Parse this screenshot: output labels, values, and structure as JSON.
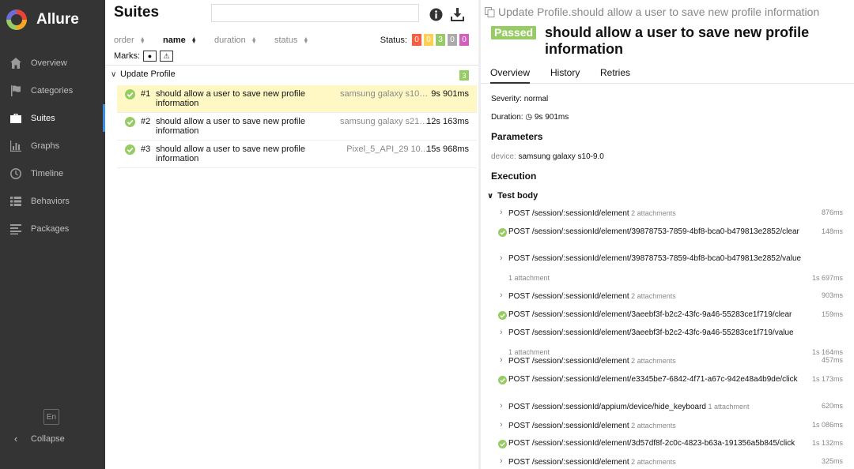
{
  "sidebar": {
    "brand": "Allure",
    "items": [
      {
        "label": "Overview",
        "icon": "home-icon"
      },
      {
        "label": "Categories",
        "icon": "flag-icon"
      },
      {
        "label": "Suites",
        "icon": "briefcase-icon",
        "active": true
      },
      {
        "label": "Graphs",
        "icon": "bar-chart-icon"
      },
      {
        "label": "Timeline",
        "icon": "clock-icon"
      },
      {
        "label": "Behaviors",
        "icon": "list-icon"
      },
      {
        "label": "Packages",
        "icon": "align-left-icon"
      }
    ],
    "language": "En",
    "collapse_label": "Collapse"
  },
  "suites": {
    "title": "Suites",
    "search_value": "",
    "sort_columns": [
      "order",
      "name",
      "duration",
      "status"
    ],
    "status_label": "Status:",
    "status_counts": [
      {
        "value": "0",
        "color": "#fd5a3e"
      },
      {
        "value": "0",
        "color": "#ffd050"
      },
      {
        "value": "3",
        "color": "#97cc64"
      },
      {
        "value": "0",
        "color": "#aaaaaa"
      },
      {
        "value": "0",
        "color": "#d35ebe"
      }
    ],
    "marks_label": "Marks:",
    "group": {
      "name": "Update Profile",
      "count": "3"
    },
    "tests": [
      {
        "num": "#1",
        "name": "should allow a user to save new profile information",
        "param": "samsung galaxy s10-…",
        "duration": "9s 901ms",
        "selected": true
      },
      {
        "num": "#2",
        "name": "should allow a user to save new profile information",
        "param": "samsung galaxy s21-…",
        "duration": "12s 163ms"
      },
      {
        "num": "#3",
        "name": "should allow a user to save new profile information",
        "param": "Pixel_5_API_29 10....",
        "duration": "15s 968ms"
      }
    ]
  },
  "details": {
    "full_path": "Update Profile.should allow a user to save new profile information",
    "status": "Passed",
    "title": "should allow a user to save new profile information",
    "tabs": [
      "Overview",
      "History",
      "Retries"
    ],
    "severity_label": "Severity:",
    "severity_value": "normal",
    "duration_label": "Duration:",
    "duration_value": "9s 901ms",
    "parameters_title": "Parameters",
    "param_key": "device",
    "param_value": "samsung galaxy s10-9.0",
    "execution_title": "Execution",
    "test_body_label": "Test body",
    "steps": [
      {
        "text": "POST /session/:sessionId/element",
        "attachments": "2 attachments",
        "duration": "876ms",
        "kind": "chevron"
      },
      {
        "text": "POST /session/:sessionId/element/39878753-7859-4bf8-bca0-b479813e2852/clear",
        "attachments": "",
        "duration": "148ms",
        "kind": "check"
      },
      {
        "text": "POST /session/:sessionId/element/39878753-7859-4bf8-bca0-b479813e2852/value",
        "attachments": "1 attachment",
        "duration": "1s 697ms",
        "kind": "chevron",
        "att_below": true
      },
      {
        "text": "POST /session/:sessionId/element",
        "attachments": "2 attachments",
        "duration": "903ms",
        "kind": "chevron"
      },
      {
        "text": "POST /session/:sessionId/element/3aeebf3f-b2c2-43fc-9a46-55283ce1f719/clear",
        "attachments": "",
        "duration": "159ms",
        "kind": "check"
      },
      {
        "text": "POST /session/:sessionId/element/3aeebf3f-b2c2-43fc-9a46-55283ce1f719/value",
        "attachments": "1 attachment",
        "duration": "1s 164ms",
        "kind": "chevron",
        "att_below": true
      },
      {
        "text": "POST /session/:sessionId/element",
        "attachments": "2 attachments",
        "duration": "457ms",
        "kind": "chevron"
      },
      {
        "text": "POST /session/:sessionId/element/e3345be7-6842-4f71-a67c-942e48a4b9de/click",
        "attachments": "",
        "duration": "1s 173ms",
        "kind": "check"
      },
      {
        "text": "POST /session/:sessionId/appium/device/hide_keyboard",
        "attachments": "1 attachment",
        "duration": "620ms",
        "kind": "chevron"
      },
      {
        "text": "POST /session/:sessionId/element",
        "attachments": "2 attachments",
        "duration": "1s 086ms",
        "kind": "chevron"
      },
      {
        "text": "POST /session/:sessionId/element/3d57df8f-2c0c-4823-b63a-191356a5b845/click",
        "attachments": "",
        "duration": "1s 132ms",
        "kind": "check"
      },
      {
        "text": "POST /session/:sessionId/element",
        "attachments": "2 attachments",
        "duration": "325ms",
        "kind": "chevron"
      }
    ]
  }
}
